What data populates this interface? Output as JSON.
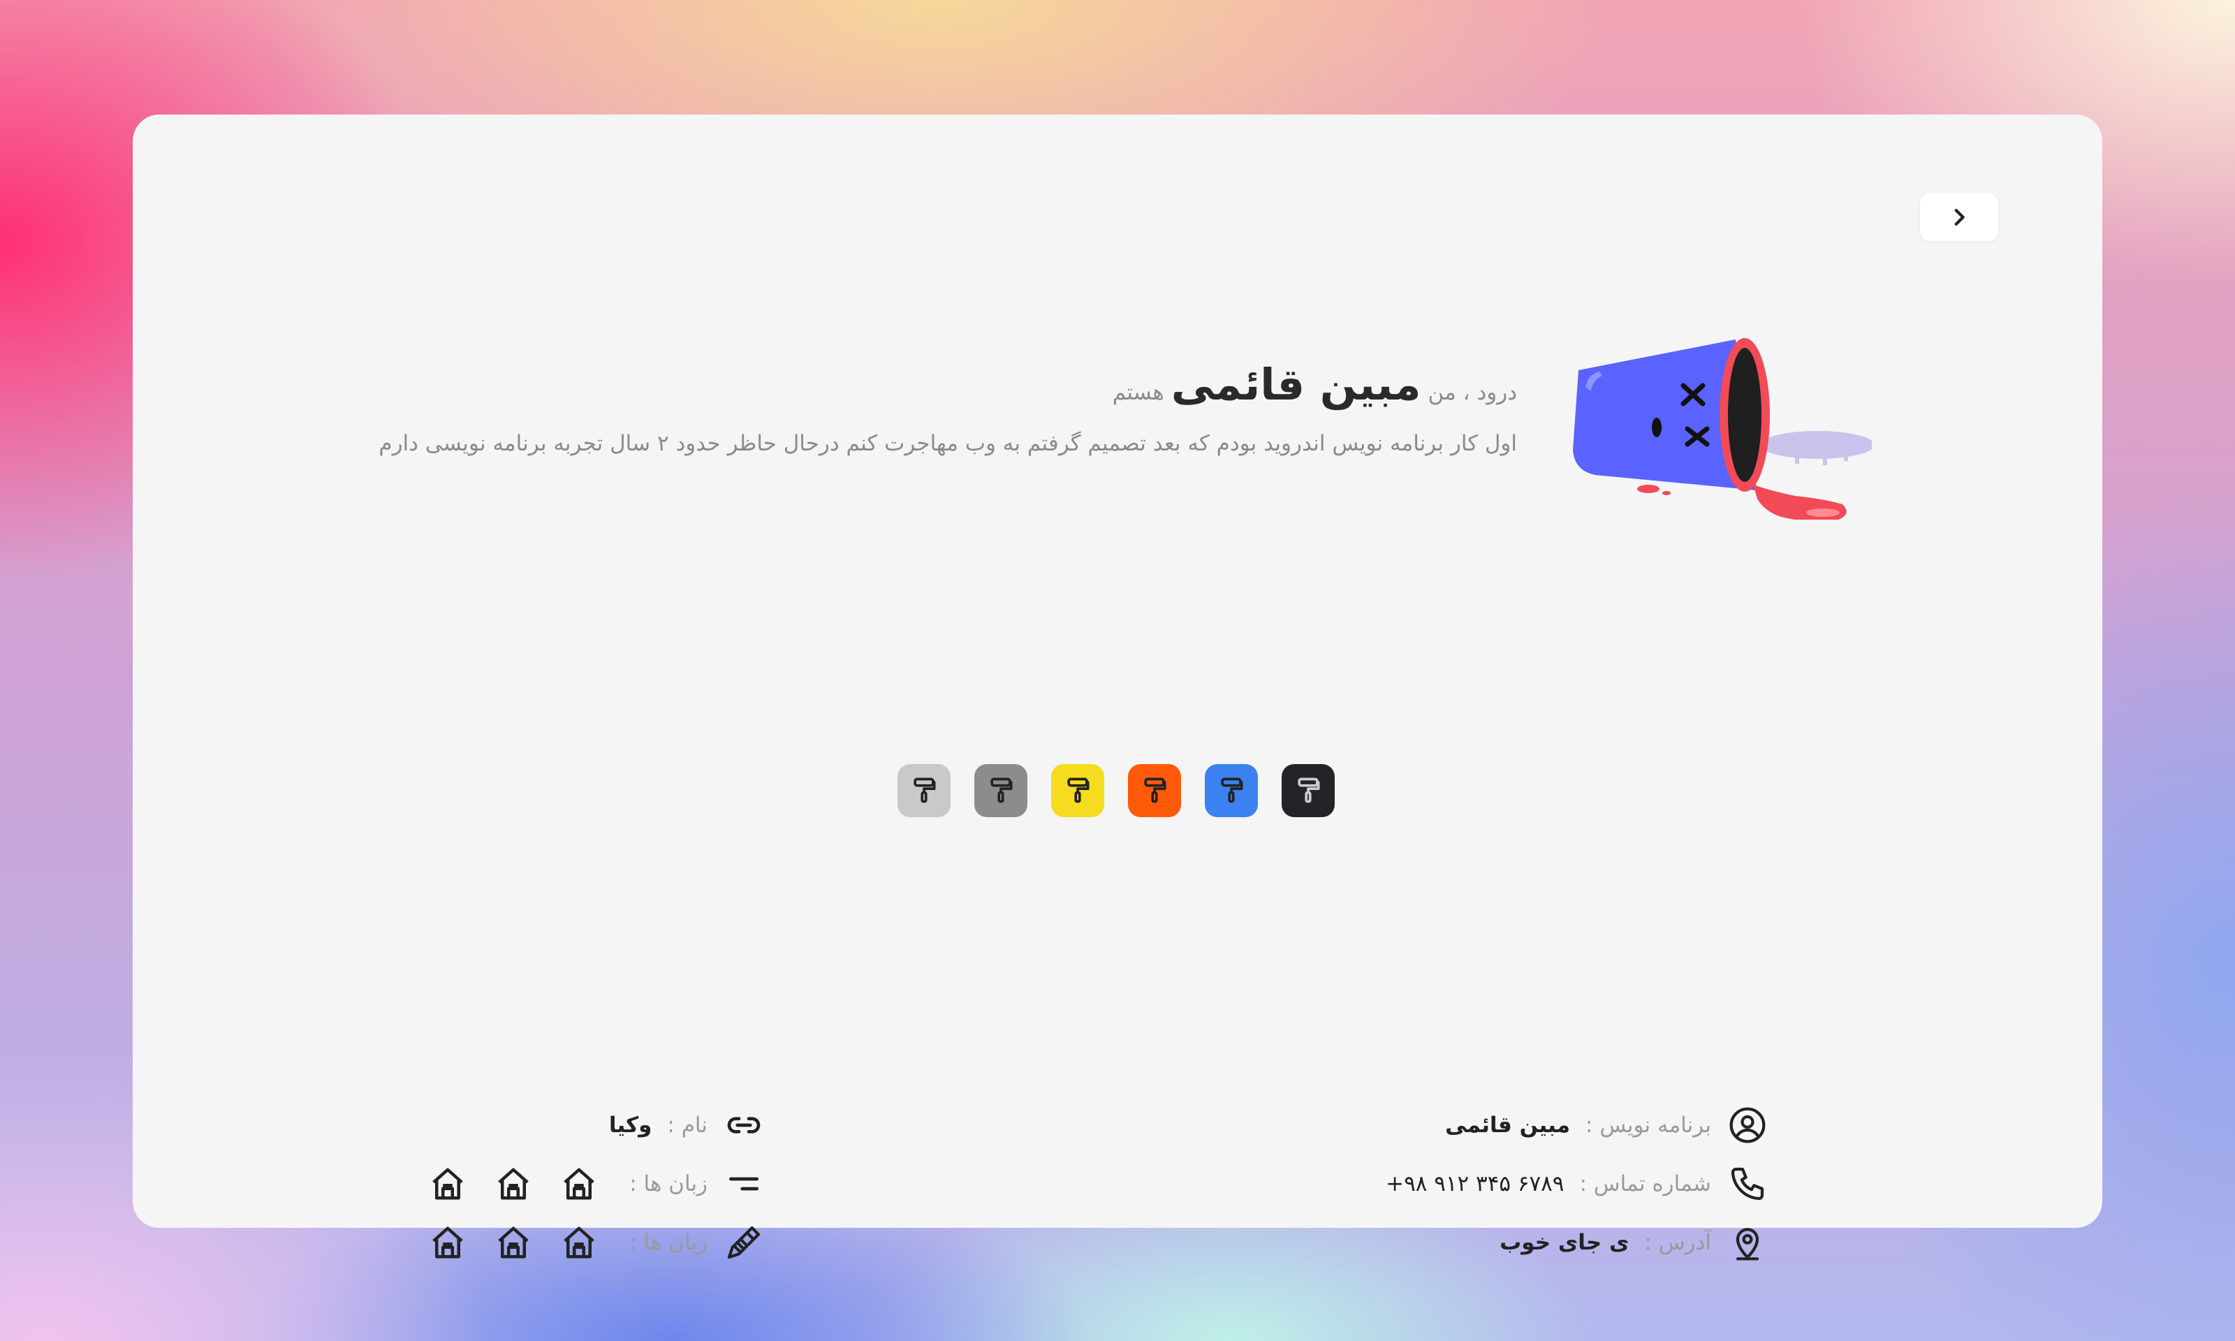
{
  "colors": {
    "card_bg": "#f5f5f5",
    "text_dark": "#2a2a2a",
    "text_muted": "#8a8a8a",
    "bucket_blue": "#5a63ff",
    "bucket_red": "#f24a57"
  },
  "nav": {
    "next_icon": "chevron-right-icon"
  },
  "intro": {
    "greeting": "درود ، من",
    "name": "مبین قائمی",
    "suffix": "هستم",
    "subtitle": "اول کار برنامه نویس اندروید بودم که بعد تصمیم گرفتم به وب مهاجرت کنم درحال حاظر حدود ۲ سال تجربه برنامه نویسی دارم"
  },
  "theme_swatches": [
    {
      "name": "light-gray",
      "color": "#c9c9c9",
      "icon": "paint-roller-icon"
    },
    {
      "name": "gray",
      "color": "#8c8c8c",
      "icon": "paint-roller-icon"
    },
    {
      "name": "yellow",
      "color": "#f6dc1f",
      "icon": "paint-roller-icon"
    },
    {
      "name": "orange",
      "color": "#ff5a0a",
      "icon": "paint-roller-icon"
    },
    {
      "name": "blue",
      "color": "#3b82f0",
      "icon": "paint-roller-icon"
    },
    {
      "name": "dark",
      "color": "#222428",
      "icon": "paint-roller-icon"
    }
  ],
  "info_right": [
    {
      "icon": "user-circle-icon",
      "label": "برنامه نویس :",
      "value": "مبین قائمی"
    },
    {
      "icon": "phone-icon",
      "label": "شماره تماس :",
      "value": "+۹۸ ۹۱۲ ۳۴۵ ۶۷۸۹"
    },
    {
      "icon": "location-pin-icon",
      "label": "آدرس :",
      "value": "ی جای خوب"
    }
  ],
  "info_left": [
    {
      "icon": "link-icon",
      "label": "نام :",
      "value": "وکیا"
    },
    {
      "icon": "lines-icon",
      "label": "زبان ها :",
      "value": ""
    },
    {
      "icon": "screw-icon",
      "label": "زبان ها :",
      "value": ""
    }
  ]
}
